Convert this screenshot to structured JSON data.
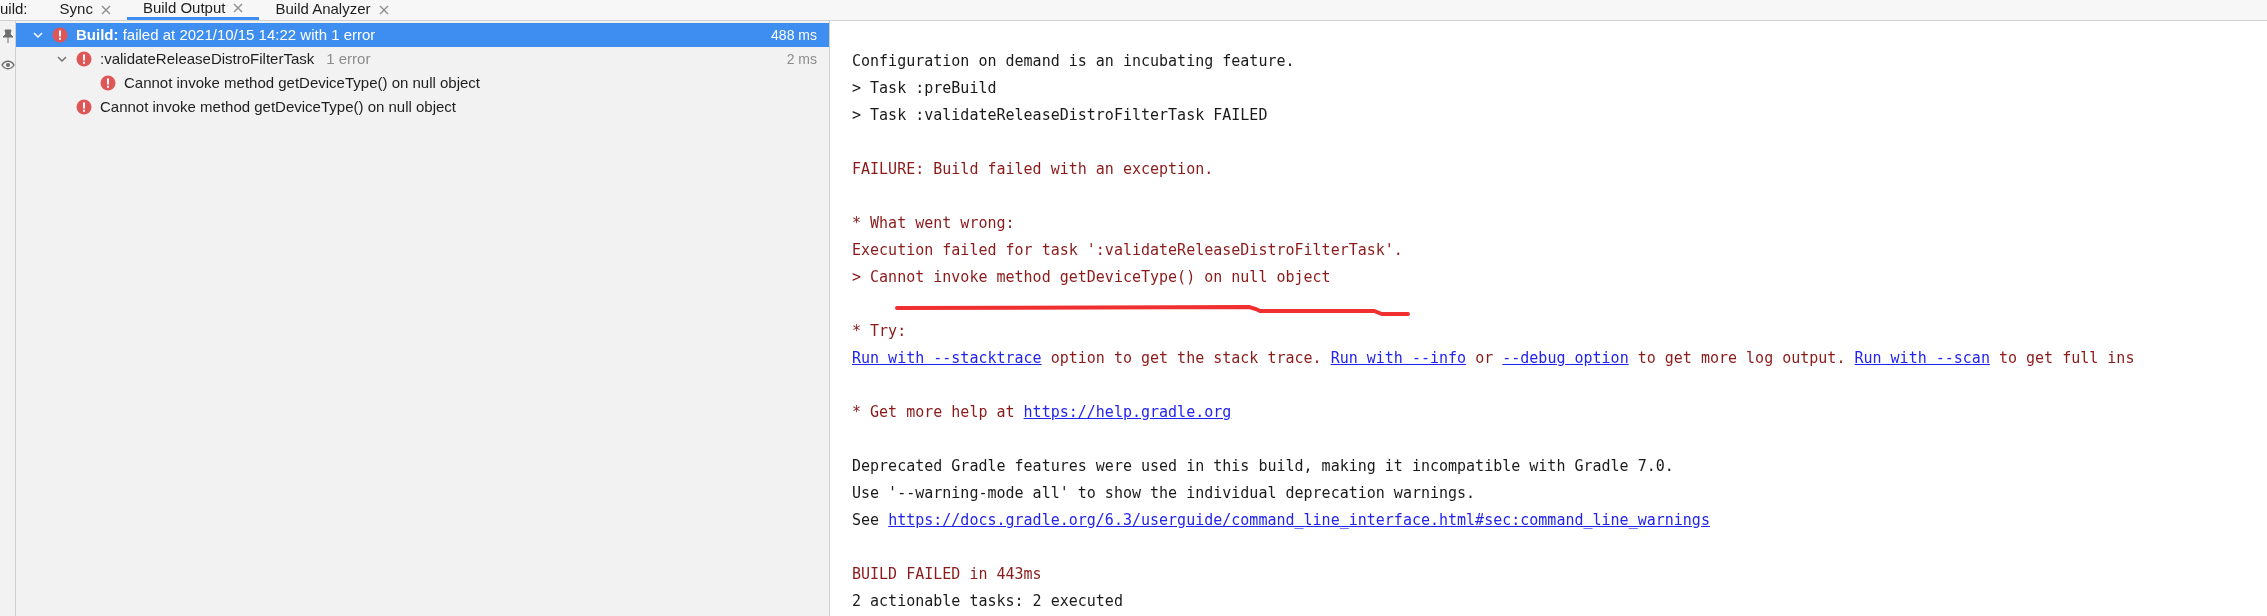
{
  "tab_bar": {
    "label": "uild:",
    "tabs": [
      {
        "label": "Sync",
        "selected": false
      },
      {
        "label": "Build Output",
        "selected": true
      },
      {
        "label": "Build Analyzer",
        "selected": false
      }
    ]
  },
  "tree": [
    {
      "title": "Build:",
      "label": "failed at 2021/10/15 14:22 with 1 error",
      "time": "488 ms",
      "selected": true,
      "expanded": true,
      "children": [
        {
          "label": ":validateReleaseDistroFilterTask",
          "note": "1 error",
          "time": "2 ms",
          "selected": false,
          "expanded": true,
          "children": [
            {
              "label": "Cannot invoke method getDeviceType() on null object",
              "selected": false
            }
          ]
        },
        {
          "label": "Cannot invoke method getDeviceType() on null object",
          "selected": false
        }
      ]
    }
  ],
  "console": {
    "blocks": [
      [
        [
          {
            "kind": "plain",
            "text": "Configuration on demand is an incubating feature."
          }
        ],
        [
          {
            "kind": "plain",
            "text": "> Task :preBuild"
          }
        ],
        [
          {
            "kind": "plain",
            "text": "> Task :validateReleaseDistroFilterTask FAILED"
          }
        ]
      ],
      [
        [
          {
            "kind": "error",
            "text": "FAILURE: Build failed with an exception."
          }
        ]
      ],
      [
        [
          {
            "kind": "error",
            "text": "* What went wrong:"
          }
        ],
        [
          {
            "kind": "error",
            "text": "Execution failed for task ':validateReleaseDistroFilterTask'."
          }
        ],
        [
          {
            "kind": "error",
            "text": "> Cannot invoke method getDeviceType() on null object"
          }
        ]
      ],
      [
        [
          {
            "kind": "error",
            "text": "* Try:"
          }
        ],
        [
          {
            "kind": "link",
            "text": "Run with --stacktrace"
          },
          {
            "kind": "error",
            "text": " option to get the stack trace. "
          },
          {
            "kind": "link",
            "text": "Run with --info"
          },
          {
            "kind": "error",
            "text": " or "
          },
          {
            "kind": "link",
            "text": "--debug option"
          },
          {
            "kind": "error",
            "text": " to get more log output. "
          },
          {
            "kind": "link",
            "text": "Run with --scan"
          },
          {
            "kind": "error",
            "text": " to get full ins"
          }
        ]
      ],
      [
        [
          {
            "kind": "error",
            "text": "* Get more help at "
          },
          {
            "kind": "link",
            "text": "https://help.gradle.org"
          }
        ]
      ],
      [
        [
          {
            "kind": "plain",
            "text": "Deprecated Gradle features were used in this build, making it incompatible with Gradle 7.0."
          }
        ],
        [
          {
            "kind": "plain",
            "text": "Use '--warning-mode all' to show the individual deprecation warnings."
          }
        ],
        [
          {
            "kind": "plain",
            "text": "See "
          },
          {
            "kind": "link",
            "text": "https://docs.gradle.org/6.3/userguide/command_line_interface.html#sec:command_line_warnings"
          }
        ]
      ],
      [
        [
          {
            "kind": "error",
            "text": "BUILD FAILED in 443ms"
          }
        ],
        [
          {
            "kind": "plain",
            "text": "2 actionable tasks: 2 executed"
          }
        ]
      ]
    ]
  }
}
